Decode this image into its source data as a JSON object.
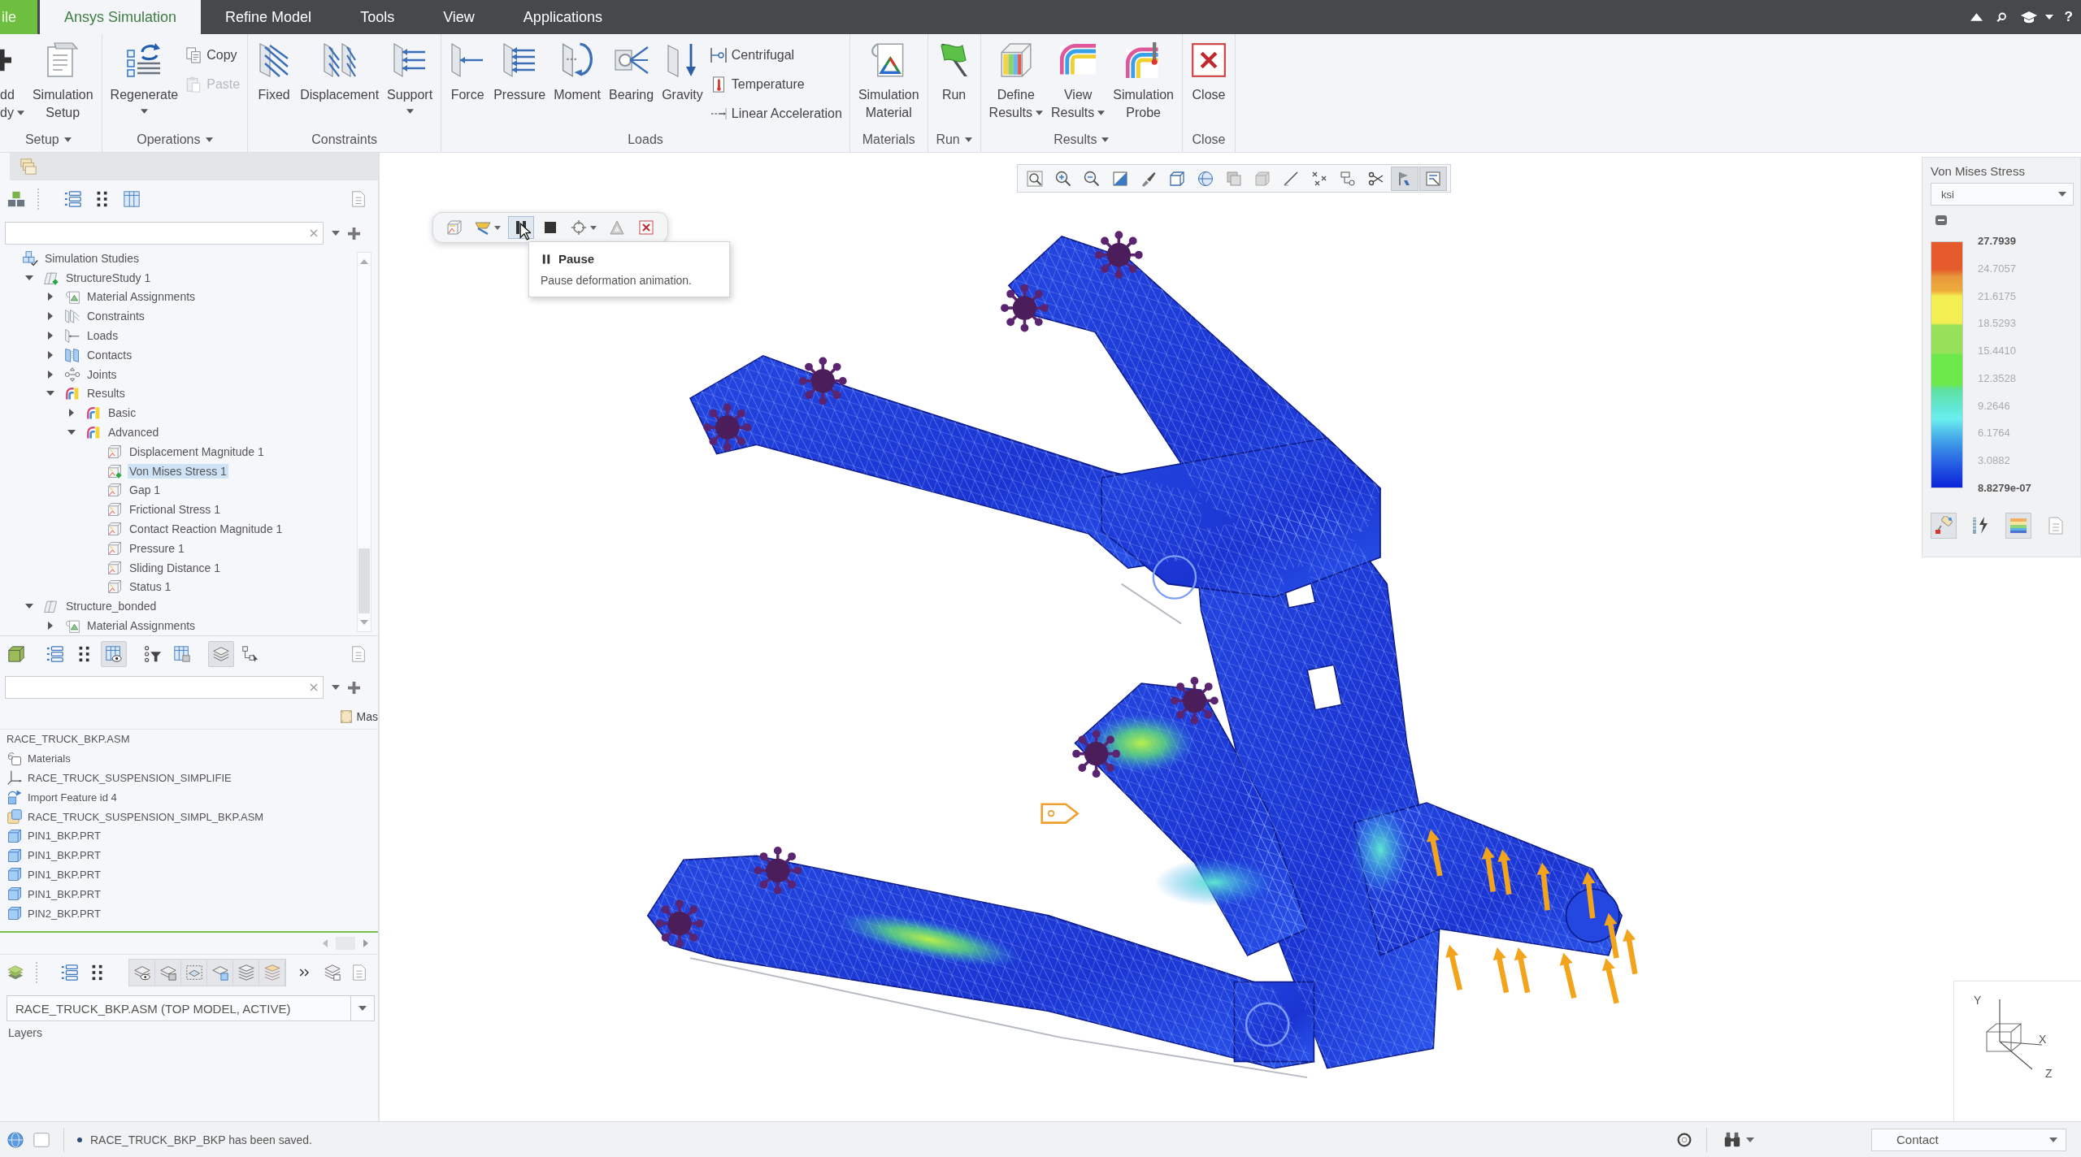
{
  "tabs": {
    "file_tab": "ile",
    "items": [
      {
        "label": "Ansys Simulation",
        "selected": true
      },
      {
        "label": "Refine Model",
        "selected": false
      },
      {
        "label": "Tools",
        "selected": false
      },
      {
        "label": "View",
        "selected": false
      },
      {
        "label": "Applications",
        "selected": false
      }
    ],
    "help": "?"
  },
  "ribbon": {
    "groups": [
      {
        "label": "Setup",
        "menu": true,
        "items": [
          {
            "kind": "large",
            "lines": [
              "dd",
              "dy"
            ],
            "menu": true
          },
          {
            "kind": "large",
            "lines": [
              "Simulation",
              "Setup"
            ],
            "menu": false
          }
        ]
      },
      {
        "label": "Operations",
        "menu": true,
        "items": [
          {
            "kind": "large",
            "lines": [
              "Regenerate"
            ],
            "menu": true
          },
          {
            "kind": "stack",
            "items": [
              {
                "label": "Copy",
                "disabled": false
              },
              {
                "label": "Paste",
                "disabled": true
              }
            ]
          }
        ]
      },
      {
        "label": "Constraints",
        "menu": false,
        "items": [
          {
            "kind": "large",
            "lines": [
              "Fixed"
            ],
            "menu": false
          },
          {
            "kind": "large",
            "lines": [
              "Displacement"
            ],
            "menu": false
          },
          {
            "kind": "large",
            "lines": [
              "Support"
            ],
            "menu": true
          }
        ]
      },
      {
        "label": "Loads",
        "menu": false,
        "items": [
          {
            "kind": "large",
            "lines": [
              "Force"
            ],
            "menu": false
          },
          {
            "kind": "large",
            "lines": [
              "Pressure"
            ],
            "menu": false
          },
          {
            "kind": "large",
            "lines": [
              "Moment"
            ],
            "menu": false
          },
          {
            "kind": "large",
            "lines": [
              "Bearing"
            ],
            "menu": false
          },
          {
            "kind": "large",
            "lines": [
              "Gravity"
            ],
            "menu": false
          },
          {
            "kind": "stack",
            "items": [
              {
                "label": "Centrifugal",
                "disabled": false
              },
              {
                "label": "Temperature",
                "disabled": false
              },
              {
                "label": "Linear Acceleration",
                "disabled": false
              }
            ]
          }
        ]
      },
      {
        "label": "Materials",
        "menu": false,
        "items": [
          {
            "kind": "large",
            "lines": [
              "Simulation",
              "Material"
            ],
            "menu": false
          }
        ]
      },
      {
        "label": "Run",
        "menu": true,
        "items": [
          {
            "kind": "large",
            "lines": [
              "Run"
            ],
            "menu": false
          }
        ]
      },
      {
        "label": "Results",
        "menu": true,
        "items": [
          {
            "kind": "large",
            "lines": [
              "Define",
              "Results"
            ],
            "menu": true
          },
          {
            "kind": "large",
            "lines": [
              "View",
              "Results"
            ],
            "menu": true
          },
          {
            "kind": "large",
            "lines": [
              "Simulation",
              "Probe"
            ],
            "menu": false
          }
        ]
      },
      {
        "label": "Close",
        "menu": false,
        "items": [
          {
            "kind": "large",
            "lines": [
              "Close"
            ],
            "menu": false
          }
        ]
      }
    ]
  },
  "study_tree": {
    "items": [
      {
        "label": "Simulation Studies",
        "kind": "studies",
        "selected": false,
        "children": [
          {
            "label": "StructureStudy 1",
            "kind": "study",
            "active": true,
            "expanded": true,
            "selected": false,
            "children": [
              {
                "label": "Material Assignments",
                "kind": "materials",
                "expanded": false,
                "selected": false
              },
              {
                "label": "Constraints",
                "kind": "constraints",
                "expanded": false,
                "selected": false
              },
              {
                "label": "Loads",
                "kind": "loads",
                "expanded": false,
                "selected": false
              },
              {
                "label": "Contacts",
                "kind": "contacts",
                "expanded": false,
                "selected": false
              },
              {
                "label": "Joints",
                "kind": "joints",
                "expanded": false,
                "selected": false
              },
              {
                "label": "Results",
                "kind": "results",
                "expanded": true,
                "selected": false,
                "children": [
                  {
                    "label": "Basic",
                    "kind": "results",
                    "expanded": false,
                    "selected": false
                  },
                  {
                    "label": "Advanced",
                    "kind": "results",
                    "expanded": true,
                    "selected": false,
                    "children": [
                      {
                        "label": "Displacement Magnitude 1",
                        "kind": "result",
                        "active": false,
                        "selected": false
                      },
                      {
                        "label": "Von Mises Stress 1",
                        "kind": "result",
                        "active": true,
                        "selected": true
                      },
                      {
                        "label": "Gap 1",
                        "kind": "result",
                        "active": false,
                        "selected": false
                      },
                      {
                        "label": "Frictional Stress 1",
                        "kind": "result",
                        "active": false,
                        "selected": false
                      },
                      {
                        "label": "Contact Reaction Magnitude 1",
                        "kind": "result",
                        "active": false,
                        "selected": false
                      },
                      {
                        "label": "Pressure 1",
                        "kind": "result",
                        "active": false,
                        "selected": false
                      },
                      {
                        "label": "Sliding Distance 1",
                        "kind": "result",
                        "active": false,
                        "selected": false
                      },
                      {
                        "label": "Status 1",
                        "kind": "result",
                        "active": false,
                        "selected": false
                      }
                    ]
                  }
                ]
              }
            ]
          },
          {
            "label": "Structure_bonded",
            "kind": "study",
            "active": false,
            "expanded": true,
            "selected": false,
            "children": [
              {
                "label": "Material Assignments",
                "kind": "materials",
                "expanded": false,
                "selected": false
              }
            ]
          }
        ]
      }
    ]
  },
  "model_toolbar": {
    "buttons": [
      {
        "selected": false
      },
      {
        "selected": false
      },
      {
        "selected": false
      },
      {
        "selected": true
      },
      {
        "selected": false
      },
      {
        "selected": false
      },
      {
        "selected": true
      },
      {
        "selected": false
      }
    ]
  },
  "model_tree": {
    "column_header": "Mas",
    "items": [
      {
        "label": "RACE_TRUCK_BKP.ASM",
        "kind": "root",
        "selected": false
      },
      {
        "label": "Materials",
        "kind": "materials",
        "selected": false
      },
      {
        "label": "RACE_TRUCK_SUSPENSION_SIMPLIFIE",
        "kind": "csys",
        "selected": false
      },
      {
        "label": "Import Feature id 4",
        "kind": "import",
        "selected": false
      },
      {
        "label": "RACE_TRUCK_SUSPENSION_SIMPL_BKP.ASM",
        "kind": "assembly",
        "selected": false
      },
      {
        "label": "PIN1_BKP.PRT",
        "kind": "part",
        "selected": false
      },
      {
        "label": "PIN1_BKP.PRT",
        "kind": "part",
        "selected": false
      },
      {
        "label": "PIN1_BKP.PRT",
        "kind": "part",
        "selected": false
      },
      {
        "label": "PIN1_BKP.PRT",
        "kind": "part",
        "selected": false
      },
      {
        "label": "PIN2_BKP.PRT",
        "kind": "part",
        "selected": false
      }
    ]
  },
  "layers": {
    "model": "RACE_TRUCK_BKP.ASM (TOP MODEL, ACTIVE)",
    "label": "Layers"
  },
  "view_toolbar": {
    "buttons": [
      {
        "selected": false
      },
      {
        "selected": false
      },
      {
        "selected": false
      },
      {
        "selected": false
      },
      {
        "selected": false
      },
      {
        "selected": false
      },
      {
        "selected": false
      },
      {
        "selected": false
      },
      {
        "selected": false
      },
      {
        "selected": false
      },
      {
        "selected": false
      },
      {
        "selected": false
      },
      {
        "selected": false
      },
      {
        "selected": true
      },
      {
        "selected": true
      }
    ]
  },
  "animation_toolbar": {
    "buttons": [
      {
        "selected": false,
        "menu": false
      },
      {
        "selected": false,
        "menu": true
      },
      {
        "selected": true,
        "menu": false
      },
      {
        "selected": false,
        "menu": false
      },
      {
        "selected": false,
        "menu": true
      },
      {
        "selected": false,
        "menu": false
      },
      {
        "selected": false,
        "menu": false
      }
    ]
  },
  "tooltip": {
    "title": "Pause",
    "text": "Pause deformation animation."
  },
  "legend": {
    "title": "Von Mises Stress",
    "unit": "ksi",
    "labels": [
      {
        "text": "27.7939",
        "kind": "limit"
      },
      {
        "text": "24.7057",
        "kind": "tick"
      },
      {
        "text": "21.6175",
        "kind": "tick"
      },
      {
        "text": "18.5293",
        "kind": "tick"
      },
      {
        "text": "15.4410",
        "kind": "tick"
      },
      {
        "text": "12.3528",
        "kind": "tick"
      },
      {
        "text": "9.2646",
        "kind": "tick"
      },
      {
        "text": "6.1764",
        "kind": "tick"
      },
      {
        "text": "3.0882",
        "kind": "tick"
      },
      {
        "text": "8.8279e-07",
        "kind": "limit"
      }
    ],
    "tools": [
      {
        "selected": true
      },
      {
        "selected": false
      },
      {
        "selected": true
      },
      {
        "selected": false
      }
    ]
  },
  "triad": {
    "axes": [
      "Y",
      "X",
      "Z"
    ]
  },
  "status_bar": {
    "message": "RACE_TRUCK_BKP_BKP has been saved.",
    "filter": "Contact"
  }
}
